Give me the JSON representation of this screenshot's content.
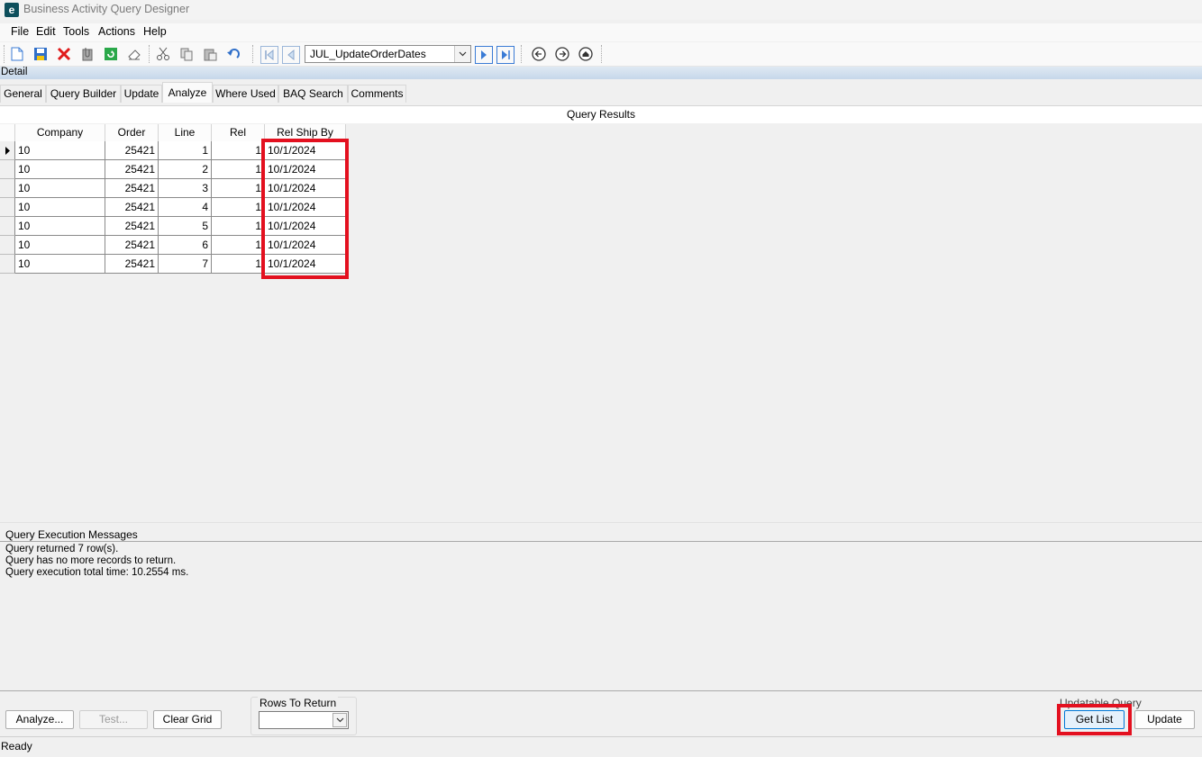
{
  "window": {
    "title": "Business Activity Query Designer",
    "app_icon_letter": "e"
  },
  "menu": [
    "File",
    "Edit",
    "Tools",
    "Actions",
    "Help"
  ],
  "toolbar": {
    "query_selector_value": "JUL_UpdateOrderDates"
  },
  "detail_label": "Detail",
  "tabs": [
    "General",
    "Query Builder",
    "Update",
    "Analyze",
    "Where Used",
    "BAQ Search",
    "Comments"
  ],
  "active_tab": "Analyze",
  "results": {
    "title": "Query Results",
    "columns": [
      "Company",
      "Order",
      "Line",
      "Rel",
      "Rel Ship By"
    ],
    "rows": [
      [
        "10",
        "25421",
        "1",
        "1",
        "10/1/2024"
      ],
      [
        "10",
        "25421",
        "2",
        "1",
        "10/1/2024"
      ],
      [
        "10",
        "25421",
        "3",
        "1",
        "10/1/2024"
      ],
      [
        "10",
        "25421",
        "4",
        "1",
        "10/1/2024"
      ],
      [
        "10",
        "25421",
        "5",
        "1",
        "10/1/2024"
      ],
      [
        "10",
        "25421",
        "6",
        "1",
        "10/1/2024"
      ],
      [
        "10",
        "25421",
        "7",
        "1",
        "10/1/2024"
      ]
    ]
  },
  "messages": {
    "title": "Query Execution Messages",
    "lines": [
      "Query returned 7 row(s).",
      "Query has no more records to return.",
      "Query execution total time: 10.2554 ms."
    ]
  },
  "bottom": {
    "analyze_label": "Analyze...",
    "test_label": "Test...",
    "clear_grid_label": "Clear Grid",
    "rows_to_return_label": "Rows To Return",
    "rows_to_return_value": "",
    "updatable_query_label": "Updatable Query",
    "get_list_label": "Get List",
    "update_label": "Update"
  },
  "status": "Ready",
  "highlight_color": "#e3101f"
}
